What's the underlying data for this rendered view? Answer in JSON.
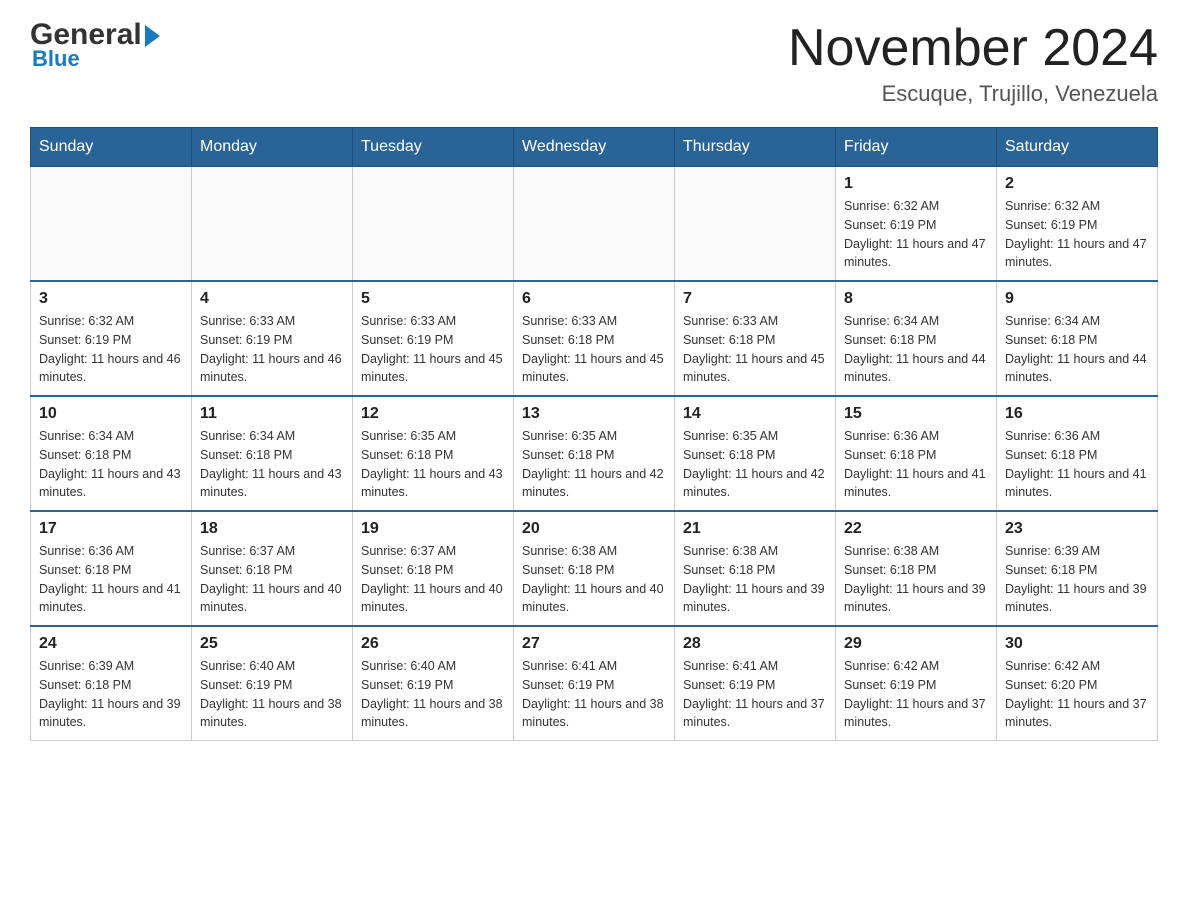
{
  "logo": {
    "text_general": "General",
    "text_blue": "Blue"
  },
  "header": {
    "month_year": "November 2024",
    "location": "Escuque, Trujillo, Venezuela"
  },
  "days_of_week": [
    "Sunday",
    "Monday",
    "Tuesday",
    "Wednesday",
    "Thursday",
    "Friday",
    "Saturday"
  ],
  "weeks": [
    [
      {
        "day": "",
        "info": ""
      },
      {
        "day": "",
        "info": ""
      },
      {
        "day": "",
        "info": ""
      },
      {
        "day": "",
        "info": ""
      },
      {
        "day": "",
        "info": ""
      },
      {
        "day": "1",
        "info": "Sunrise: 6:32 AM\nSunset: 6:19 PM\nDaylight: 11 hours and 47 minutes."
      },
      {
        "day": "2",
        "info": "Sunrise: 6:32 AM\nSunset: 6:19 PM\nDaylight: 11 hours and 47 minutes."
      }
    ],
    [
      {
        "day": "3",
        "info": "Sunrise: 6:32 AM\nSunset: 6:19 PM\nDaylight: 11 hours and 46 minutes."
      },
      {
        "day": "4",
        "info": "Sunrise: 6:33 AM\nSunset: 6:19 PM\nDaylight: 11 hours and 46 minutes."
      },
      {
        "day": "5",
        "info": "Sunrise: 6:33 AM\nSunset: 6:19 PM\nDaylight: 11 hours and 45 minutes."
      },
      {
        "day": "6",
        "info": "Sunrise: 6:33 AM\nSunset: 6:18 PM\nDaylight: 11 hours and 45 minutes."
      },
      {
        "day": "7",
        "info": "Sunrise: 6:33 AM\nSunset: 6:18 PM\nDaylight: 11 hours and 45 minutes."
      },
      {
        "day": "8",
        "info": "Sunrise: 6:34 AM\nSunset: 6:18 PM\nDaylight: 11 hours and 44 minutes."
      },
      {
        "day": "9",
        "info": "Sunrise: 6:34 AM\nSunset: 6:18 PM\nDaylight: 11 hours and 44 minutes."
      }
    ],
    [
      {
        "day": "10",
        "info": "Sunrise: 6:34 AM\nSunset: 6:18 PM\nDaylight: 11 hours and 43 minutes."
      },
      {
        "day": "11",
        "info": "Sunrise: 6:34 AM\nSunset: 6:18 PM\nDaylight: 11 hours and 43 minutes."
      },
      {
        "day": "12",
        "info": "Sunrise: 6:35 AM\nSunset: 6:18 PM\nDaylight: 11 hours and 43 minutes."
      },
      {
        "day": "13",
        "info": "Sunrise: 6:35 AM\nSunset: 6:18 PM\nDaylight: 11 hours and 42 minutes."
      },
      {
        "day": "14",
        "info": "Sunrise: 6:35 AM\nSunset: 6:18 PM\nDaylight: 11 hours and 42 minutes."
      },
      {
        "day": "15",
        "info": "Sunrise: 6:36 AM\nSunset: 6:18 PM\nDaylight: 11 hours and 41 minutes."
      },
      {
        "day": "16",
        "info": "Sunrise: 6:36 AM\nSunset: 6:18 PM\nDaylight: 11 hours and 41 minutes."
      }
    ],
    [
      {
        "day": "17",
        "info": "Sunrise: 6:36 AM\nSunset: 6:18 PM\nDaylight: 11 hours and 41 minutes."
      },
      {
        "day": "18",
        "info": "Sunrise: 6:37 AM\nSunset: 6:18 PM\nDaylight: 11 hours and 40 minutes."
      },
      {
        "day": "19",
        "info": "Sunrise: 6:37 AM\nSunset: 6:18 PM\nDaylight: 11 hours and 40 minutes."
      },
      {
        "day": "20",
        "info": "Sunrise: 6:38 AM\nSunset: 6:18 PM\nDaylight: 11 hours and 40 minutes."
      },
      {
        "day": "21",
        "info": "Sunrise: 6:38 AM\nSunset: 6:18 PM\nDaylight: 11 hours and 39 minutes."
      },
      {
        "day": "22",
        "info": "Sunrise: 6:38 AM\nSunset: 6:18 PM\nDaylight: 11 hours and 39 minutes."
      },
      {
        "day": "23",
        "info": "Sunrise: 6:39 AM\nSunset: 6:18 PM\nDaylight: 11 hours and 39 minutes."
      }
    ],
    [
      {
        "day": "24",
        "info": "Sunrise: 6:39 AM\nSunset: 6:18 PM\nDaylight: 11 hours and 39 minutes."
      },
      {
        "day": "25",
        "info": "Sunrise: 6:40 AM\nSunset: 6:19 PM\nDaylight: 11 hours and 38 minutes."
      },
      {
        "day": "26",
        "info": "Sunrise: 6:40 AM\nSunset: 6:19 PM\nDaylight: 11 hours and 38 minutes."
      },
      {
        "day": "27",
        "info": "Sunrise: 6:41 AM\nSunset: 6:19 PM\nDaylight: 11 hours and 38 minutes."
      },
      {
        "day": "28",
        "info": "Sunrise: 6:41 AM\nSunset: 6:19 PM\nDaylight: 11 hours and 37 minutes."
      },
      {
        "day": "29",
        "info": "Sunrise: 6:42 AM\nSunset: 6:19 PM\nDaylight: 11 hours and 37 minutes."
      },
      {
        "day": "30",
        "info": "Sunrise: 6:42 AM\nSunset: 6:20 PM\nDaylight: 11 hours and 37 minutes."
      }
    ]
  ]
}
